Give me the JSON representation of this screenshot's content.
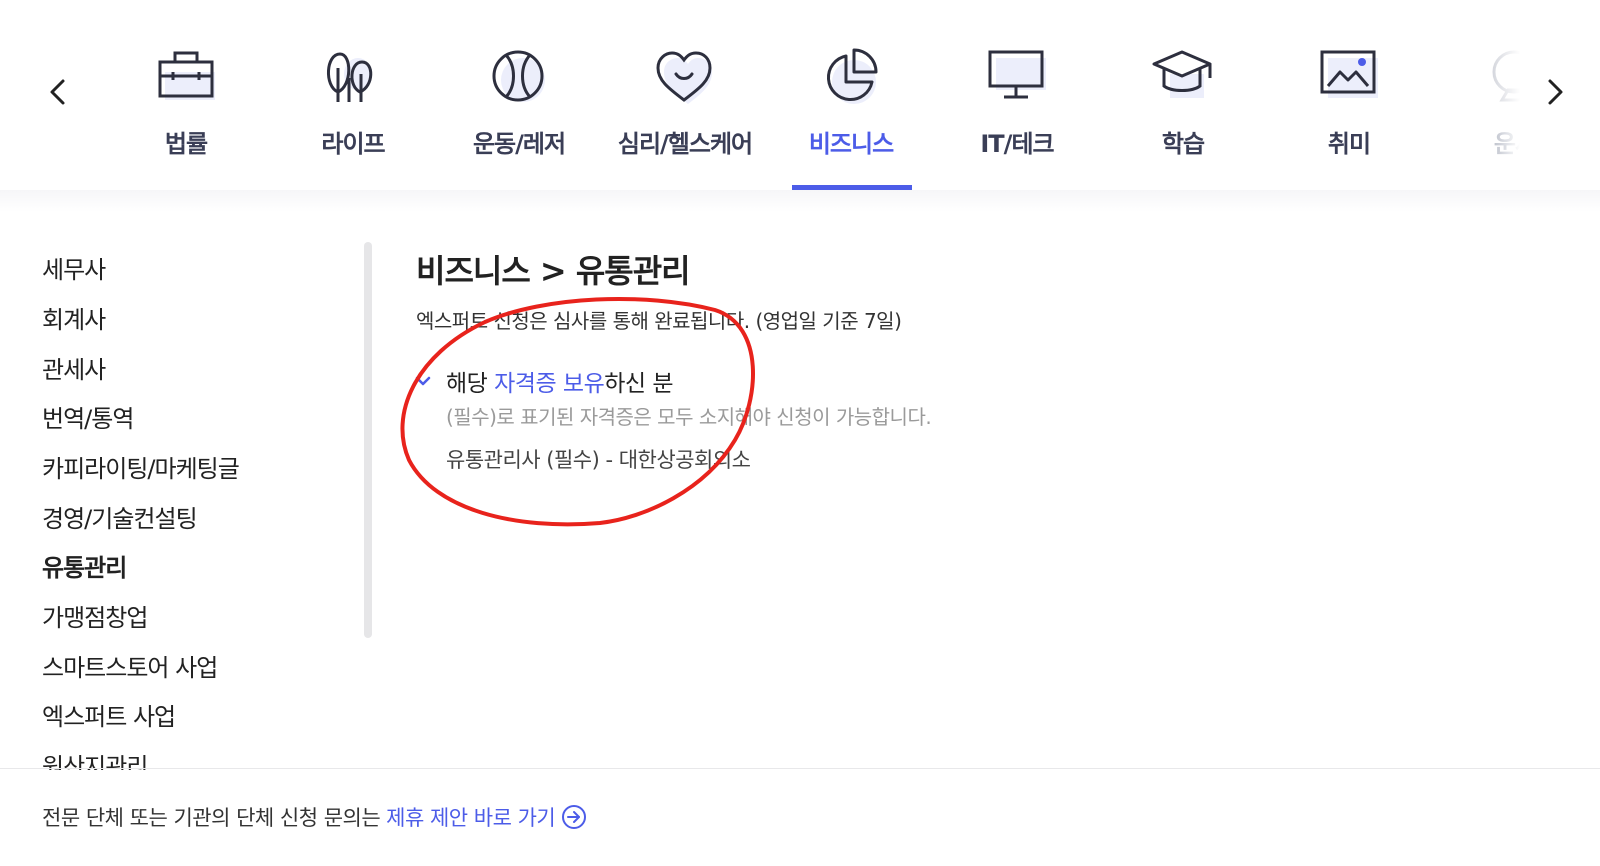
{
  "categories": [
    {
      "label": "법률",
      "icon": "briefcase-icon"
    },
    {
      "label": "라이프",
      "icon": "trees-icon"
    },
    {
      "label": "운동/레저",
      "icon": "ball-icon"
    },
    {
      "label": "심리/헬스케어",
      "icon": "heart-smile-icon"
    },
    {
      "label": "비즈니스",
      "icon": "pie-chart-icon",
      "active": true
    },
    {
      "label": "IT/테크",
      "icon": "monitor-icon"
    },
    {
      "label": "학습",
      "icon": "graduation-cap-icon"
    },
    {
      "label": "취미",
      "icon": "picture-icon"
    },
    {
      "label": "운세",
      "icon": "fortune-icon"
    }
  ],
  "sidebar": {
    "items": [
      {
        "label": "세무사"
      },
      {
        "label": "회계사"
      },
      {
        "label": "관세사"
      },
      {
        "label": "번역/통역"
      },
      {
        "label": "카피라이팅/마케팅글"
      },
      {
        "label": "경영/기술컨설팅"
      },
      {
        "label": "유통관리",
        "active": true
      },
      {
        "label": "가맹점창업"
      },
      {
        "label": "스마트스토어 사업"
      },
      {
        "label": "엑스퍼트 사업"
      },
      {
        "label": "원산지관리"
      }
    ]
  },
  "main": {
    "title": "비즈니스 > 유통관리",
    "description": "엑스퍼트 신청은 심사를 통해 완료됩니다. (영업일 기준 7일)",
    "requirement": {
      "prefix": "해당 ",
      "highlight": "자격증 보유",
      "suffix": "하신 분",
      "note": "(필수)로 표기된 자격증은 모두 소지해야 신청이 가능합니다.",
      "item": "유통관리사 (필수) - 대한상공회의소"
    }
  },
  "footer": {
    "text": "전문 단체 또는 기관의 단체 신청 문의는",
    "link": "제휴 제안 바로 가기"
  },
  "colors": {
    "accent": "#4c5ce8",
    "annotation": "#e8231c"
  }
}
